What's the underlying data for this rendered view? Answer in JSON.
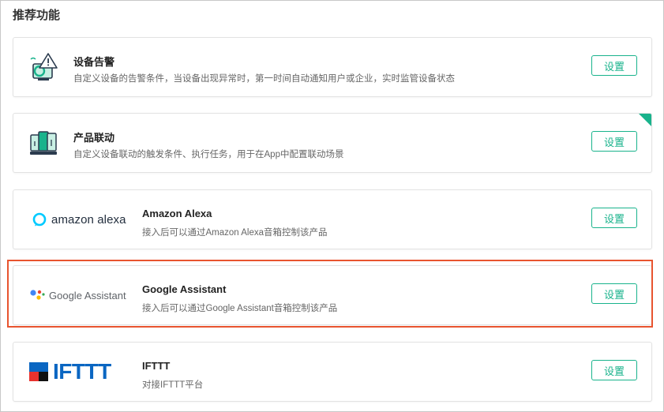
{
  "section": {
    "title": "推荐功能"
  },
  "features": [
    {
      "title": "设备告警",
      "desc": "自定义设备的告警条件，当设备出现异常时，第一时间自动通知用户或企业，实时监管设备状态",
      "button": "设置"
    },
    {
      "title": "产品联动",
      "desc": "自定义设备联动的触发条件、执行任务，用于在App中配置联动场景",
      "button": "设置"
    },
    {
      "title": "Amazon Alexa",
      "desc": "接入后可以通过Amazon Alexa音箱控制该产品",
      "button": "设置",
      "logo_text": "amazon alexa"
    },
    {
      "title": "Google Assistant",
      "desc": "接入后可以通过Google Assistant音箱控制该产品",
      "button": "设置",
      "logo_text": "Google Assistant"
    },
    {
      "title": "IFTTT",
      "desc": "对接IFTTT平台",
      "button": "设置",
      "logo_text": "IFTTT"
    }
  ],
  "colors": {
    "accent": "#19b38c",
    "highlight": "#e8542f",
    "ifttt_blue": "#0a66c2",
    "alexa_cyan": "#00caff"
  },
  "icons": [
    "alert-device-icon",
    "linkage-device-icon",
    "alexa-ring-icon",
    "google-dots-icon",
    "ifttt-flag-icon"
  ]
}
